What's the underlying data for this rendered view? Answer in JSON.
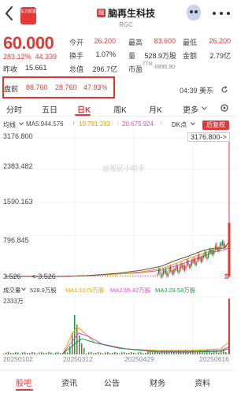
{
  "header": {
    "logo_text": "东方财富",
    "badge": "融",
    "title": "脑再生科技",
    "subtitle": "RGC"
  },
  "quote": {
    "price": "60.000",
    "change_pct": "283.12%",
    "change_abs": "44.339",
    "prev_close_label": "昨收",
    "prev_close": "15.661",
    "fields": [
      {
        "label": "今开",
        "value": "26.200",
        "color": "red"
      },
      {
        "label": "最高",
        "value": "83.600",
        "color": "red"
      },
      {
        "label": "最低",
        "value": "26.200",
        "color": "red"
      },
      {
        "label": "换手",
        "value": "1.07%",
        "color": "dark"
      },
      {
        "label": "量",
        "value": "528.9万股",
        "color": "dark"
      },
      {
        "label": "金额",
        "value": "2.79亿",
        "color": "dark"
      },
      {
        "label": "总值",
        "value": "296.7亿",
        "color": "dark"
      },
      {
        "label": "市盈",
        "value": "-6896.90",
        "color": "gray"
      }
    ],
    "pe_prefix": "TTM"
  },
  "premarket": {
    "label": "盘前",
    "price": "88.760",
    "change": "28.760",
    "pct": "47.93%",
    "time": "04:39 美东"
  },
  "tabs": [
    "分时",
    "五日",
    "日K",
    "周K",
    "月K",
    "更多"
  ],
  "active_tab": "日K",
  "ma": {
    "label": "均线",
    "ma5": "MA5:944.576",
    "ma10": "10:791.283",
    "ma20": "20:675.924",
    "dk": "DK点",
    "adjust": "后复权"
  },
  "chart_data": {
    "type": "candlestick",
    "y_ticks": [
      "3176.800",
      "2383.482",
      "1590.163",
      "796.845",
      "3.526"
    ],
    "y_min_label": "3.526",
    "min_marker": "<-3.526",
    "max_marker": "3176.800->",
    "x_ticks": [
      "20250102",
      "20250312",
      "20250429",
      "20250616"
    ],
    "watermark": "@股民小助手"
  },
  "volume": {
    "label": "成交量",
    "vol": "528.9万股",
    "ma1": "MA1:1079万股",
    "ma2": "MA2:55.42万股",
    "ma3": "MA3:29.58万股",
    "y_max": "2333万"
  },
  "bottom_nav": [
    "股吧",
    "资讯",
    "公告",
    "财务",
    "资料"
  ],
  "bottom_active": "股吧"
}
